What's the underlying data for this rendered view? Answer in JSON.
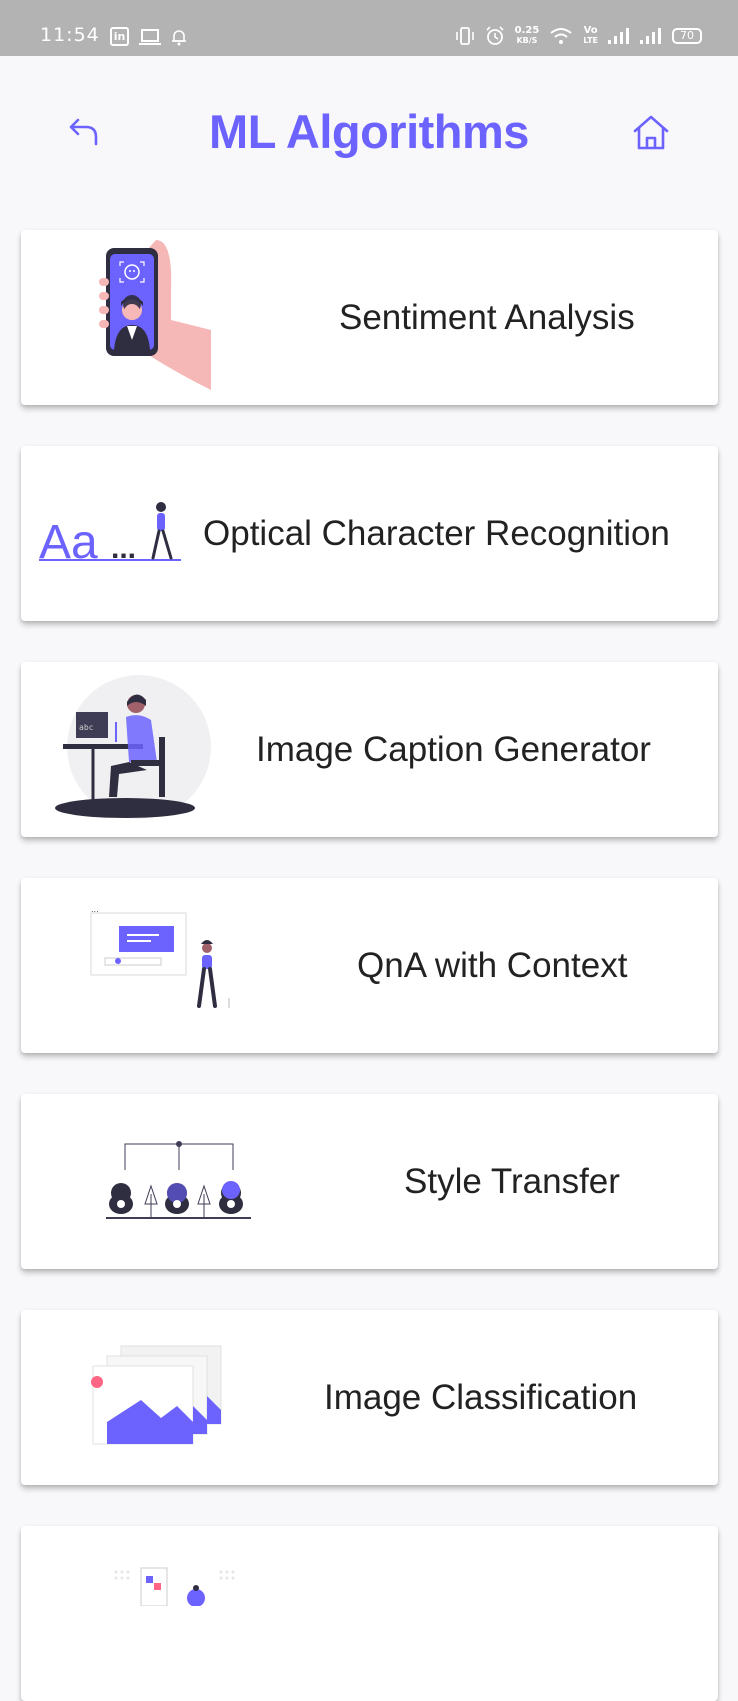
{
  "status_bar": {
    "time": "11:54",
    "network_speed_value": "0.25",
    "network_speed_unit": "KB/S",
    "volte_top": "Vo",
    "volte_bottom": "LTE",
    "battery": "70",
    "icons": [
      "linkedin-icon",
      "laptop-icon",
      "notification-bell-icon",
      "vibrate-icon",
      "alarm-icon",
      "wifi-icon",
      "signal-icon",
      "signal-icon",
      "battery-icon"
    ]
  },
  "header": {
    "title": "ML Algorithms",
    "back_icon": "back-arrow-icon",
    "home_icon": "home-icon"
  },
  "algorithms": [
    {
      "label": "Sentiment Analysis",
      "illustration": "phone-face-scan-illustration"
    },
    {
      "label": "Optical Character Recognition",
      "illustration": "text-recognition-illustration"
    },
    {
      "label": "Image Caption Generator",
      "illustration": "person-at-computer-illustration"
    },
    {
      "label": "QnA with Context",
      "illustration": "person-with-message-board-illustration"
    },
    {
      "label": "Style Transfer",
      "illustration": "style-transfer-illustration"
    },
    {
      "label": "Image Classification",
      "illustration": "stacked-images-illustration"
    }
  ],
  "colors": {
    "accent": "#6c63ff",
    "status_bar": "#b3b3b3",
    "background": "#f8f8fb",
    "card": "#ffffff",
    "text": "#222222"
  }
}
